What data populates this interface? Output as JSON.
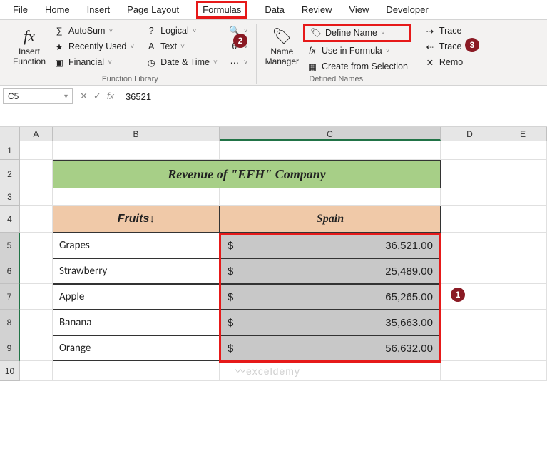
{
  "tabs": {
    "file": "File",
    "home": "Home",
    "insert": "Insert",
    "pagelayout": "Page Layout",
    "formulas": "Formulas",
    "data": "Data",
    "review": "Review",
    "view": "View",
    "developer": "Developer"
  },
  "ribbon": {
    "insertFunction": "Insert\nFunction",
    "autosum": "AutoSum",
    "recently": "Recently Used",
    "financial": "Financial",
    "logical": "Logical",
    "text": "Text",
    "datetime": "Date & Time",
    "lookup": "",
    "math": "",
    "more": "",
    "nameManager": "Name\nManager",
    "defineName": "Define Name",
    "useInFormula": "Use in Formula",
    "createFrom": "Create from Selection",
    "trace1": "Trace",
    "trace2": "Trace",
    "remo": "Remo",
    "groupFuncLib": "Function Library",
    "groupDefNames": "Defined Names"
  },
  "badges": {
    "b1": "1",
    "b2": "2",
    "b3": "3"
  },
  "formulaBar": {
    "nameBox": "C5",
    "value": "36521"
  },
  "cols": {
    "A": "A",
    "B": "B",
    "C": "C",
    "D": "D",
    "E": "E"
  },
  "rows": {
    "r1": "1",
    "r2": "2",
    "r3": "3",
    "r4": "4",
    "r5": "5",
    "r6": "6",
    "r7": "7",
    "r8": "8",
    "r9": "9",
    "r10": "10"
  },
  "table": {
    "title": "Revenue of \"EFH\" Company",
    "hdrFruits": "Fruits ",
    "hdrSpain": "Spain",
    "fruits": [
      "Grapes",
      "Strawberry",
      "Apple",
      "Banana",
      "Orange"
    ],
    "currency": "$",
    "values": [
      "36,521.00",
      "25,489.00",
      "65,265.00",
      "35,663.00",
      "56,632.00"
    ]
  },
  "watermark": "exceldemy"
}
